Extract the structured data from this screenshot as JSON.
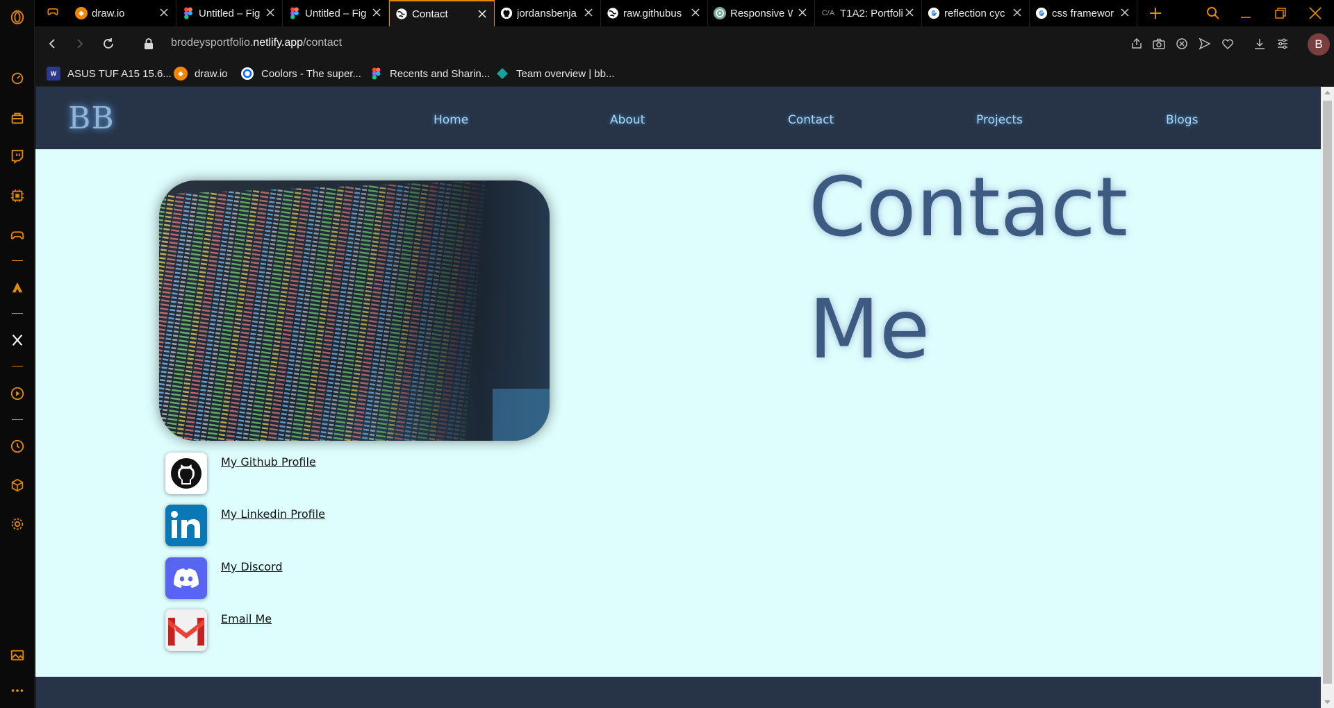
{
  "browser": {
    "tabs": [
      {
        "title": "",
        "icon": "gamepad-icon"
      },
      {
        "title": "draw.io",
        "icon": "drawio-icon",
        "color": "#f08705"
      },
      {
        "title": "Untitled – Fig",
        "icon": "figma-icon",
        "color": "#f24e1e"
      },
      {
        "title": "Untitled – Fig",
        "icon": "figma-icon",
        "color": "#f24e1e"
      },
      {
        "title": "Contact",
        "icon": "globe-icon",
        "color": "#ffffff"
      },
      {
        "title": "jordansbenja",
        "icon": "github-icon",
        "color": "#ffffff"
      },
      {
        "title": "raw.githubus",
        "icon": "globe-icon",
        "color": "#ffffff"
      },
      {
        "title": "Responsive W",
        "icon": "chatgpt-icon",
        "color": "#74aa9c"
      },
      {
        "title": "T1A2: Portfoli",
        "icon": "ca-icon",
        "color": "#888888"
      },
      {
        "title": "reflection cyc",
        "icon": "google-icon",
        "color": "#4285f4"
      },
      {
        "title": "css framewor",
        "icon": "google-icon",
        "color": "#4285f4"
      }
    ],
    "ca_glyph": "C/A",
    "url_prefix": "brodeysportfolio.",
    "url_domain": "netlify.app",
    "url_path": "/contact",
    "profile_initial": "B",
    "bookmarks": [
      {
        "label": "ASUS TUF A15 15.6...",
        "icon": "asus-icon",
        "color": "#2a3a8c"
      },
      {
        "label": "draw.io",
        "icon": "drawio-icon",
        "color": "#f08705"
      },
      {
        "label": "Coolors - The super...",
        "icon": "coolors-icon",
        "color": "#0066ff"
      },
      {
        "label": "Recents and Sharin...",
        "icon": "figma-icon",
        "color": "#f24e1e"
      },
      {
        "label": "Team overview | bb...",
        "icon": "diamond-icon",
        "color": "#17a39a"
      }
    ],
    "accent": "#e58a00"
  },
  "site": {
    "logo": "BB",
    "nav": [
      "Home",
      "About",
      "Contact",
      "Projects",
      "Blogs"
    ],
    "title_line1": "Contact",
    "title_line2": "Me",
    "links": [
      {
        "label": "My Github Profile",
        "icon": "github-icon"
      },
      {
        "label": "My Linkedin Profile",
        "icon": "linkedin-icon"
      },
      {
        "label": "My Discord",
        "icon": "discord-icon"
      },
      {
        "label": "Email Me",
        "icon": "gmail-icon"
      }
    ],
    "colors": {
      "page_bg": "#defdfd",
      "nav_bg": "#273447",
      "nav_text": "#a9d6f2",
      "title": "#3d5a80"
    }
  }
}
